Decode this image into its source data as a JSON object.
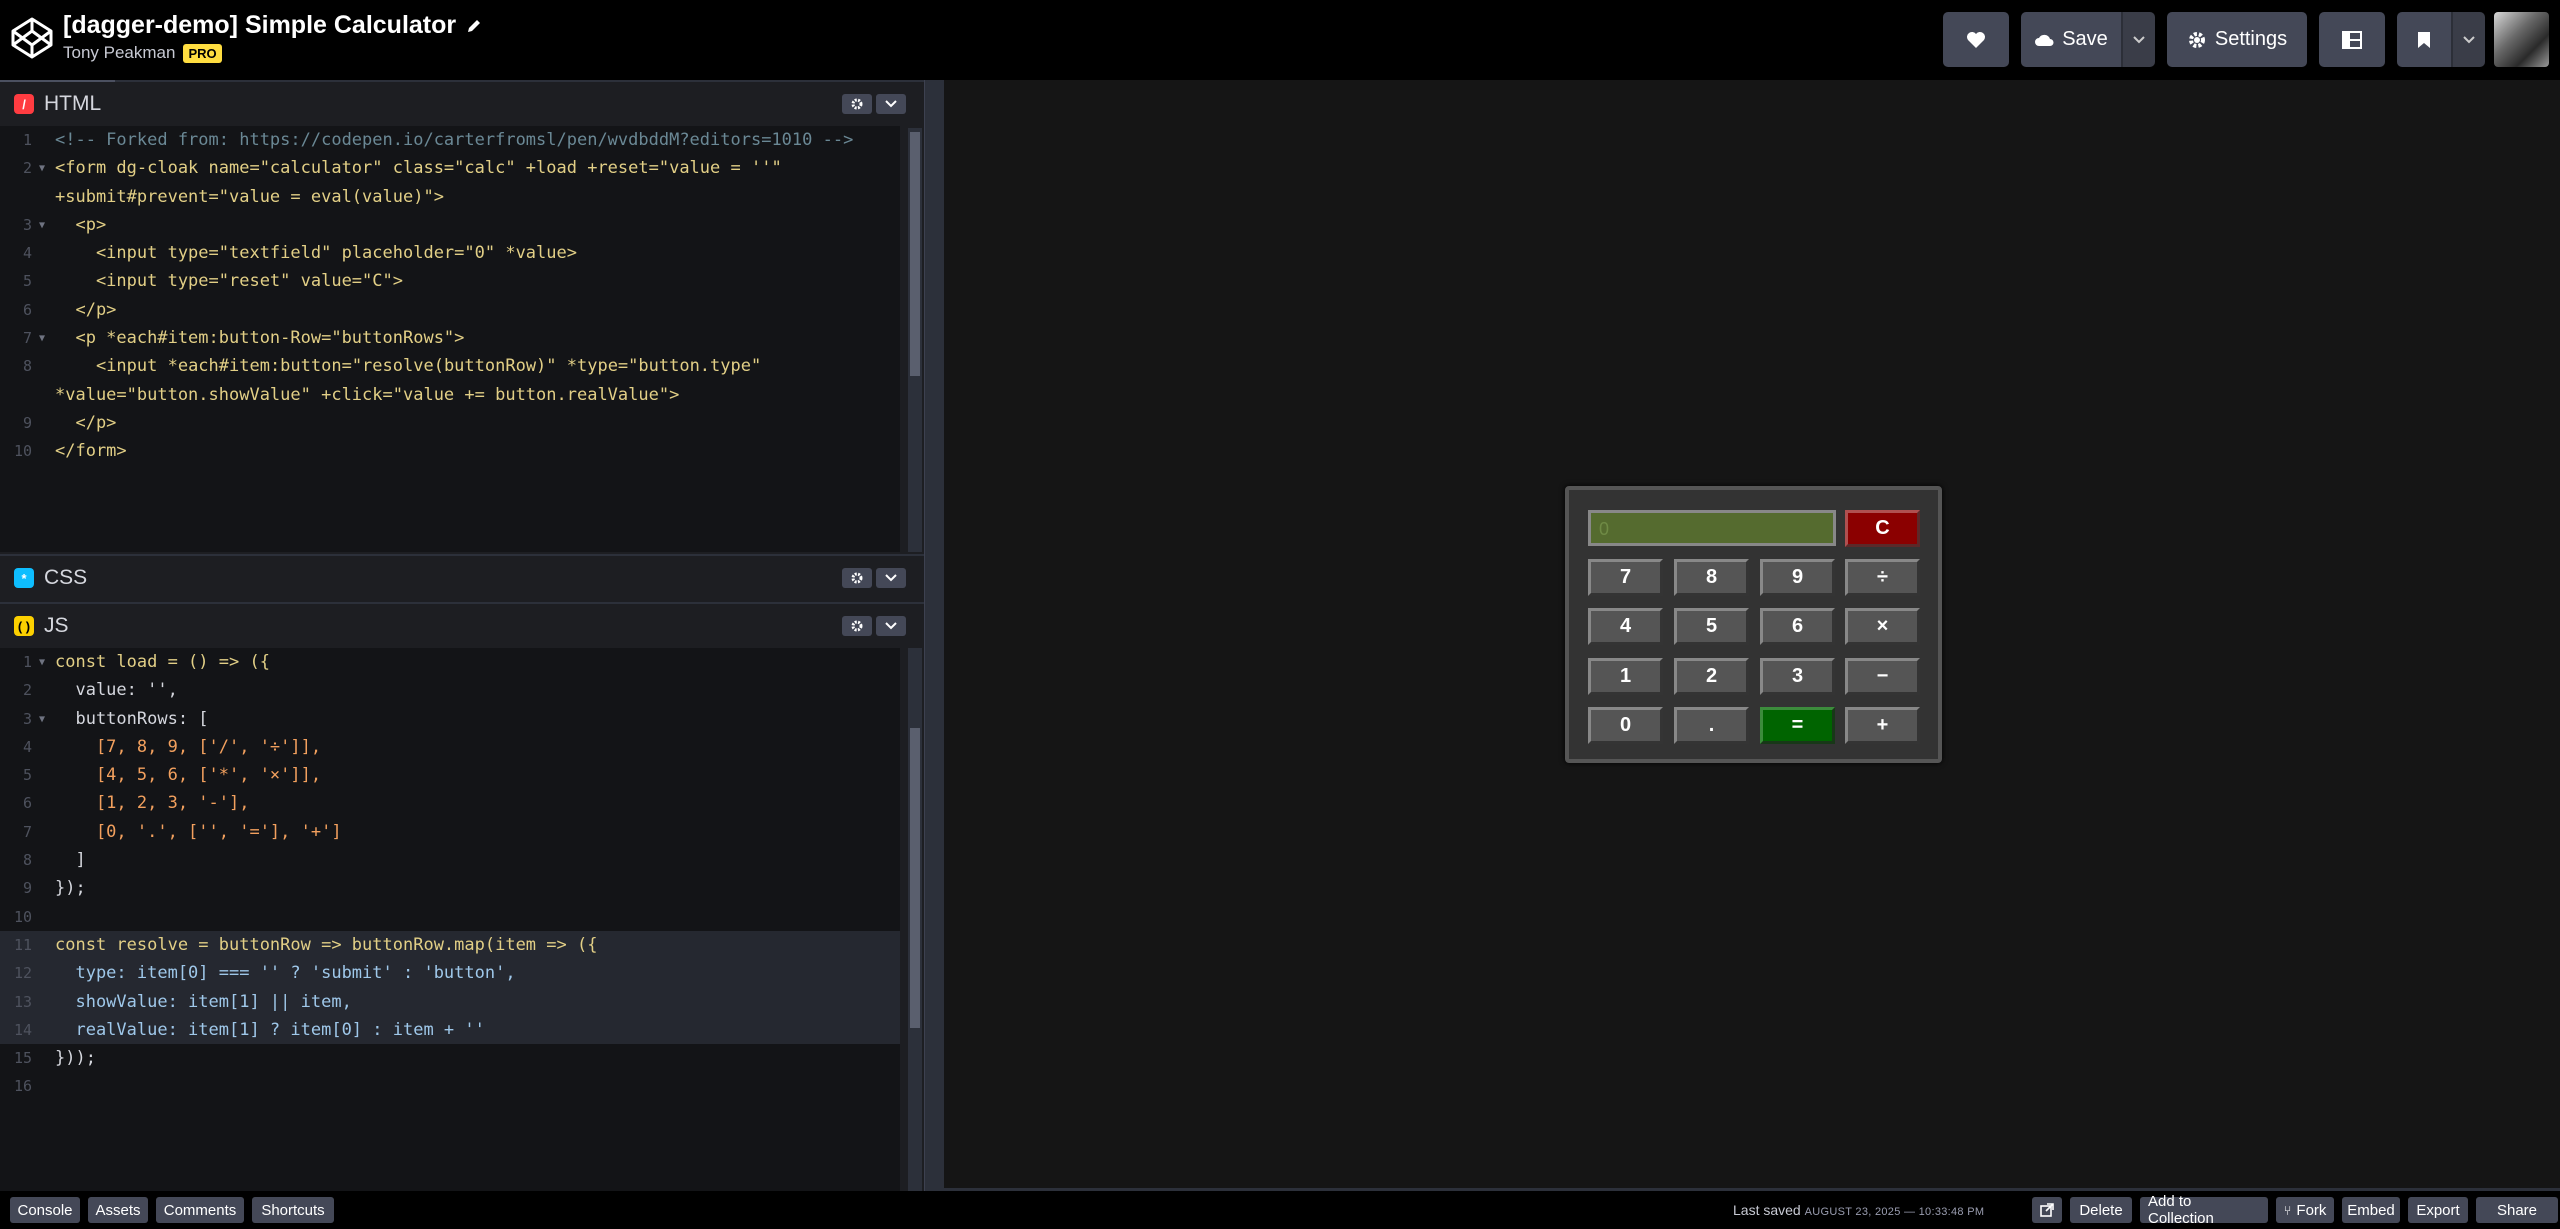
{
  "header": {
    "title": "[dagger-demo] Simple Calculator",
    "author": "Tony Peakman",
    "pro_badge": "PRO",
    "save_label": "Save",
    "settings_label": "Settings"
  },
  "editors": {
    "html": {
      "name": "HTML",
      "lines": [
        {
          "n": "1",
          "text": "<!-- Forked from: https://codepen.io/carterfromsl/pen/wvdbddM?editors=1010 -->"
        },
        {
          "n": "2",
          "text": "<form dg-cloak name=\"calculator\" class=\"calc\" +load +reset=\"value = ''\" +submit#prevent=\"value = eval(value)\">"
        },
        {
          "n": "3",
          "text": "  <p>"
        },
        {
          "n": "4",
          "text": "    <input type=\"textfield\" placeholder=\"0\" *value>"
        },
        {
          "n": "5",
          "text": "    <input type=\"reset\" value=\"C\">"
        },
        {
          "n": "6",
          "text": "  </p>"
        },
        {
          "n": "7",
          "text": "  <p *each#item:button-Row=\"buttonRows\">"
        },
        {
          "n": "8",
          "text": "    <input *each#item:button=\"resolve(buttonRow)\" *type=\"button.type\" *value=\"button.showValue\" +click=\"value += button.realValue\">"
        },
        {
          "n": "9",
          "text": "  </p>"
        },
        {
          "n": "10",
          "text": "</form>"
        }
      ]
    },
    "css": {
      "name": "CSS"
    },
    "js": {
      "name": "JS",
      "lines": [
        {
          "n": "1",
          "text": "const load = () => ({"
        },
        {
          "n": "2",
          "text": "  value: '',"
        },
        {
          "n": "3",
          "text": "  buttonRows: ["
        },
        {
          "n": "4",
          "text": "    [7, 8, 9, ['/', '÷']],"
        },
        {
          "n": "5",
          "text": "    [4, 5, 6, ['*', '×']],"
        },
        {
          "n": "6",
          "text": "    [1, 2, 3, '-'],"
        },
        {
          "n": "7",
          "text": "    [0, '.', ['', '='], '+']"
        },
        {
          "n": "8",
          "text": "  ]"
        },
        {
          "n": "9",
          "text": "});"
        },
        {
          "n": "10",
          "text": ""
        },
        {
          "n": "11",
          "text": "const resolve = buttonRow => buttonRow.map(item => ({"
        },
        {
          "n": "12",
          "text": "  type: item[0] === '' ? 'submit' : 'button',"
        },
        {
          "n": "13",
          "text": "  showValue: item[1] || item,"
        },
        {
          "n": "14",
          "text": "  realValue: item[1] ? item[0] : item + ''"
        },
        {
          "n": "15",
          "text": "}));"
        },
        {
          "n": "16",
          "text": ""
        }
      ]
    }
  },
  "calculator": {
    "display_placeholder": "0",
    "clear": "C",
    "rows": [
      [
        "7",
        "8",
        "9",
        "÷"
      ],
      [
        "4",
        "5",
        "6",
        "×"
      ],
      [
        "1",
        "2",
        "3",
        "−"
      ],
      [
        "0",
        ".",
        "=",
        "+"
      ]
    ]
  },
  "footer": {
    "console": "Console",
    "assets": "Assets",
    "comments": "Comments",
    "shortcuts": "Shortcuts",
    "last_saved_label": "Last saved",
    "last_saved_date": "AUGUST 23, 2025 — 10:33:48 PM",
    "delete": "Delete",
    "add_to_collection": "Add to Collection",
    "fork": "Fork",
    "embed": "Embed",
    "export": "Export",
    "share": "Share"
  },
  "colors": {
    "html_icon": "#ff3c41",
    "css_icon": "#0ebeff",
    "js_icon": "#fcd000",
    "display_bg": "#556b2f",
    "clear_bg": "#8b0000",
    "equals_bg": "#006400"
  }
}
